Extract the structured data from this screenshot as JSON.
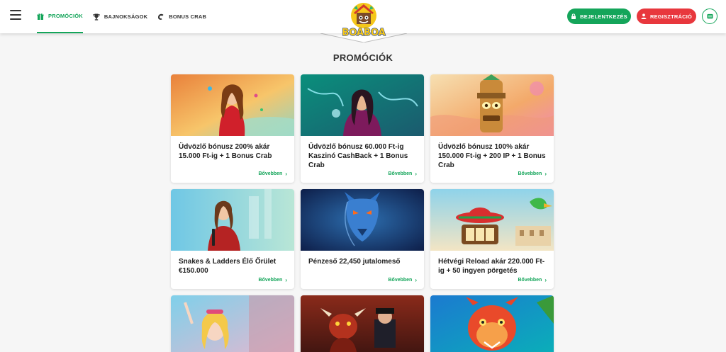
{
  "header": {
    "nav": [
      {
        "label": "PROMÓCIÓK",
        "icon": "gift-icon",
        "active": true
      },
      {
        "label": "BAJNOKSÁGOK",
        "icon": "trophy-icon",
        "active": false
      },
      {
        "label": "BONUS CRAB",
        "icon": "crab-claw-icon",
        "active": false
      }
    ],
    "logo_text": "BOABOA",
    "login_label": "BEJELENTKEZÉS",
    "register_label": "REGISZTRÁCIÓ"
  },
  "page": {
    "title": "PROMÓCIÓK"
  },
  "cards": [
    {
      "title": "Üdvözlő bónusz 200% akár 15.000 Ft-ig + 1 Bonus Crab",
      "more": "Bővebben"
    },
    {
      "title": "Üdvözlő bónusz 60.000 Ft-ig Kaszinó CashBack + 1 Bonus Crab",
      "more": "Bővebben"
    },
    {
      "title": "Üdvözlő bónusz 100% akár 150.000 Ft-ig + 200 IP + 1 Bonus Crab",
      "more": "Bővebben"
    },
    {
      "title": "Snakes & Ladders Élő Őrület €150.000",
      "more": "Bővebben"
    },
    {
      "title": "Pénzeső 22,450 jutalomeső",
      "more": "Bővebben"
    },
    {
      "title": "Hétvégi Reload akár 220.000 Ft-ig + 50 ingyen pörgetés",
      "more": "Bővebben"
    },
    {
      "title": "",
      "more": ""
    },
    {
      "title": "",
      "more": ""
    },
    {
      "title": "",
      "more": ""
    }
  ],
  "colors": {
    "accent_green": "#14a55a",
    "accent_red": "#e8373d"
  }
}
